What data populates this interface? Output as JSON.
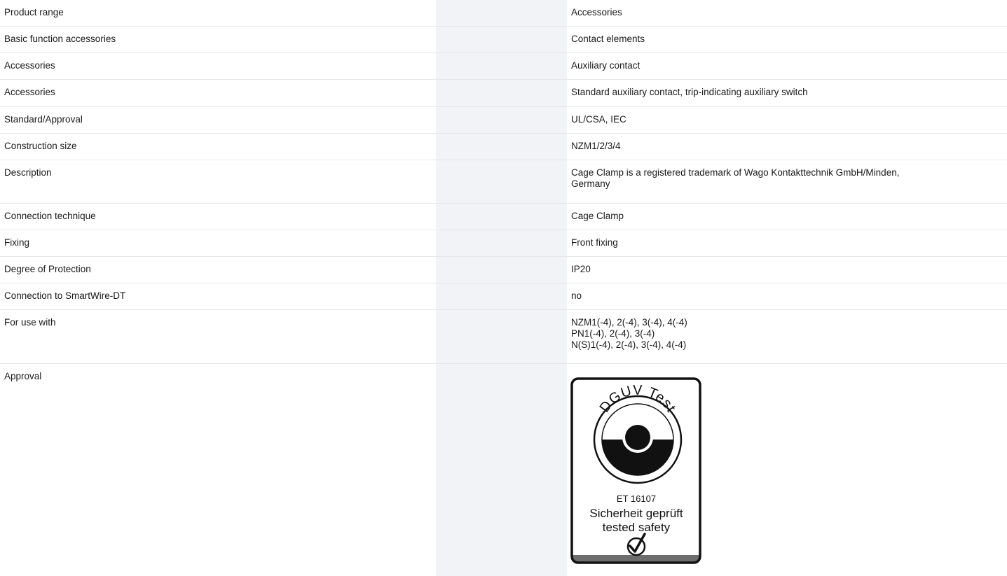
{
  "rows": [
    {
      "label": "Product range",
      "value": "Accessories"
    },
    {
      "label": "Basic function accessories",
      "value": "Contact elements"
    },
    {
      "label": "Accessories",
      "value": "Auxiliary contact"
    },
    {
      "label": "Accessories",
      "value": "Standard auxiliary contact, trip-indicating auxiliary switch"
    },
    {
      "label": "Standard/Approval",
      "value": "UL/CSA, IEC"
    },
    {
      "label": "Construction size",
      "value": "NZM1/2/3/4"
    },
    {
      "label": "Description",
      "value_lines": [
        "Cage Clamp is a registered trademark of Wago Kontakttechnik GmbH/Minden,",
        "Germany"
      ]
    },
    {
      "label": "Connection technique",
      "value": "Cage Clamp"
    },
    {
      "label": "Fixing",
      "value": "Front fixing"
    },
    {
      "label": "Degree of Protection",
      "value": "IP20"
    },
    {
      "label": "Connection to SmartWire-DT",
      "value": "no"
    },
    {
      "label": "For use with",
      "value_lines": [
        "NZM1(-4), 2(-4), 3(-4), 4(-4)",
        "PN1(-4), 2(-4), 3(-4)",
        "N(S)1(-4), 2(-4), 3(-4), 4(-4)"
      ]
    },
    {
      "label": "Approval"
    }
  ],
  "approval_badge": {
    "arc_text": "DGUV Test",
    "number": "ET 16107",
    "line1": "Sicherheit geprüft",
    "line2": "tested safety"
  }
}
